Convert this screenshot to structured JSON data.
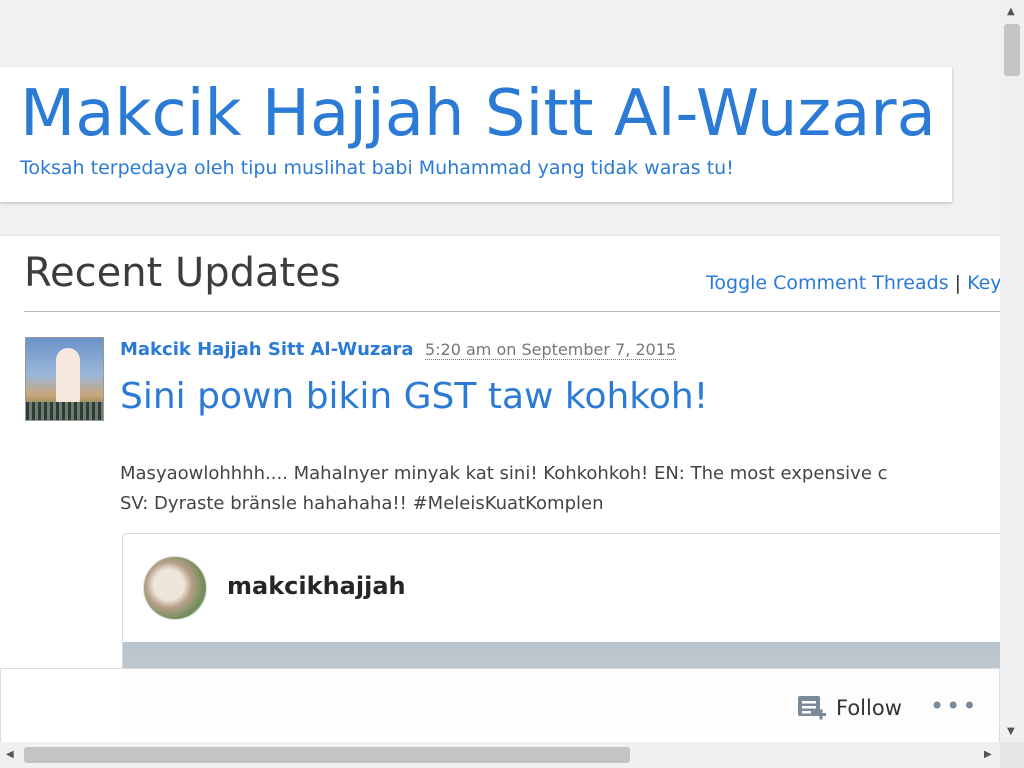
{
  "site": {
    "title": "Makcik Hajjah Sitt Al-Wuzara",
    "description": "Toksah terpedaya oleh tipu muslihat babi Muhammad yang tidak waras tu!"
  },
  "section": {
    "title": "Recent Updates",
    "toggle_link": "Toggle Comment Threads",
    "separator": "|",
    "keyboard_link": "Key"
  },
  "post": {
    "author": "Makcik Hajjah Sitt Al-Wuzara",
    "date": "5:20 am on September 7, 2015",
    "title": "Sini pown bikin GST taw kohkoh!",
    "body_line1": "Masyaowlohhhh.... Mahalnyer minyak kat sini! Kohkohkoh! EN: The most expensive c",
    "body_line2": "SV: Dyraste bränsle hahahaha!! #MeleisKuatKomplen",
    "embed": {
      "username": "makcikhajjah"
    }
  },
  "follow_bar": {
    "follow_label": "Follow",
    "more_label": "•••"
  },
  "scrollbar": {
    "up": "▲",
    "down": "▼",
    "left": "◀",
    "right": "▶"
  }
}
